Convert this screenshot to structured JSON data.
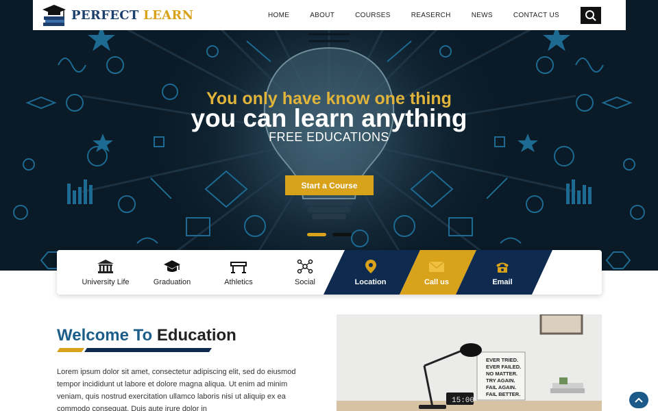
{
  "brand": {
    "name_part1": "PERFECT",
    "name_part2": "LEARN"
  },
  "nav": {
    "items": [
      {
        "label": "HOME"
      },
      {
        "label": "ABOUT"
      },
      {
        "label": "COURSES"
      },
      {
        "label": "REASERCH"
      },
      {
        "label": "NEWS"
      },
      {
        "label": "CONTACT US"
      }
    ],
    "search_icon": "search-icon"
  },
  "hero": {
    "line1": "You only have know one thing",
    "line2": "you can learn anything",
    "line3": "FREE EDUCATIONS",
    "cta_label": "Start a Course",
    "slides": 2,
    "active_slide": 1
  },
  "features": [
    {
      "label": "University Life",
      "icon": "university-icon"
    },
    {
      "label": "Graduation",
      "icon": "graduation-cap-icon"
    },
    {
      "label": "Athletics",
      "icon": "hurdle-icon"
    },
    {
      "label": "Social",
      "icon": "social-network-icon"
    },
    {
      "label": "Location",
      "icon": "location-pin-icon"
    },
    {
      "label": "Call us",
      "icon": "email-icon"
    },
    {
      "label": "Email",
      "icon": "phone-icon"
    }
  ],
  "welcome": {
    "title_part1": "Welcome To",
    "title_part2": "Education",
    "body": "Lorem ipsum dolor sit amet, consectetur adipiscing elit, sed do eiusmod tempor incididunt ut labore et dolore magna aliqua. Ut enim ad minim veniam, quis nostrud exercitation ullamco laboris nisi ut aliquip ex ea commodo consequat. Duis aute irure dolor in"
  },
  "photo": {
    "poster_lines": [
      "EVER TRIED.",
      "EVER FAILED.",
      "NO MATTER.",
      "TRY AGAIN.",
      "FAIL AGAIN.",
      "FAIL BETTER."
    ],
    "clock_text": "15:00"
  },
  "colors": {
    "navy": "#0e2a4f",
    "gold": "#d9a21b",
    "title_blue": "#1c5d8a",
    "hero_dark": "#0f2230"
  }
}
